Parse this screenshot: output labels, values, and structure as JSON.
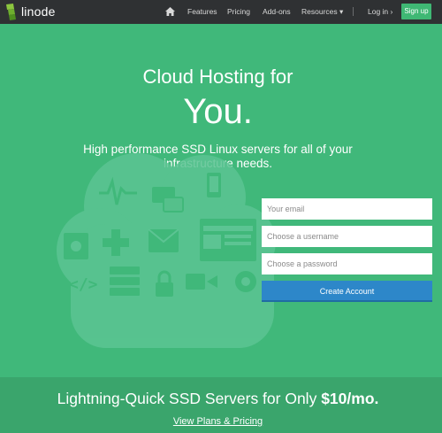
{
  "nav": {
    "logo_text": "linode",
    "links": [
      "Features",
      "Pricing",
      "Add-ons",
      "Resources ▾",
      "Log in ›"
    ],
    "signup_label": "Sign up"
  },
  "hero": {
    "title_line1": "Cloud Hosting for",
    "title_line2": "You.",
    "subtitle_line1": "High performance SSD Linux servers for all of your",
    "subtitle_line2": "infrastructure needs."
  },
  "signup_form": {
    "email_placeholder": "Your email",
    "username_placeholder": "Choose a username",
    "password_placeholder": "Choose a password",
    "submit_label": "Create Account"
  },
  "promo": {
    "title_prefix": "Lightning-Quick SSD Servers for Only",
    "title_price": "$10/mo.",
    "link_label": "View Plans & Pricing"
  },
  "colors": {
    "background": "#40b87a",
    "navbar": "#2f3133",
    "button": "#2d87c9",
    "promo_band": "#3aa56c"
  },
  "icons": [
    "linode-logo-icon",
    "home-icon",
    "cloud-illustration"
  ]
}
